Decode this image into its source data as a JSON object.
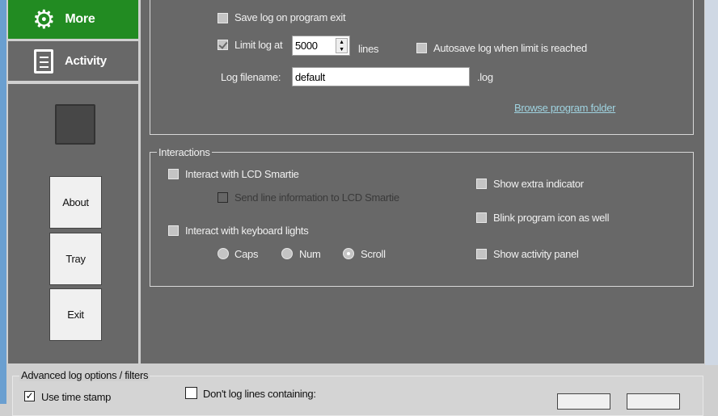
{
  "sidebar": {
    "more": "More",
    "activity": "Activity",
    "about": "About",
    "tray": "Tray",
    "exit": "Exit"
  },
  "log": {
    "save_on_exit": "Save log on program exit",
    "limit_label": "Limit log at",
    "limit_value": "5000",
    "lines": "lines",
    "autosave": "Autosave log when limit is reached",
    "filename_label": "Log filename:",
    "filename_value": "default",
    "ext": ".log",
    "browse": "Browse program folder"
  },
  "interactions": {
    "title": "Interactions",
    "lcd": "Interact with LCD Smartie",
    "send_line": "Send line information to LCD Smartie",
    "keyboard": "Interact with keyboard lights",
    "caps": "Caps",
    "num": "Num",
    "scroll": "Scroll",
    "extra": "Show extra indicator",
    "blink": "Blink program icon as well",
    "activity_panel": "Show activity panel"
  },
  "advanced": {
    "title": "Advanced log options / filters",
    "timestamp": "Use time stamp",
    "dont_log": "Don't log lines containing:"
  },
  "colors": {
    "accent": "#228b22",
    "panel": "#686868"
  }
}
